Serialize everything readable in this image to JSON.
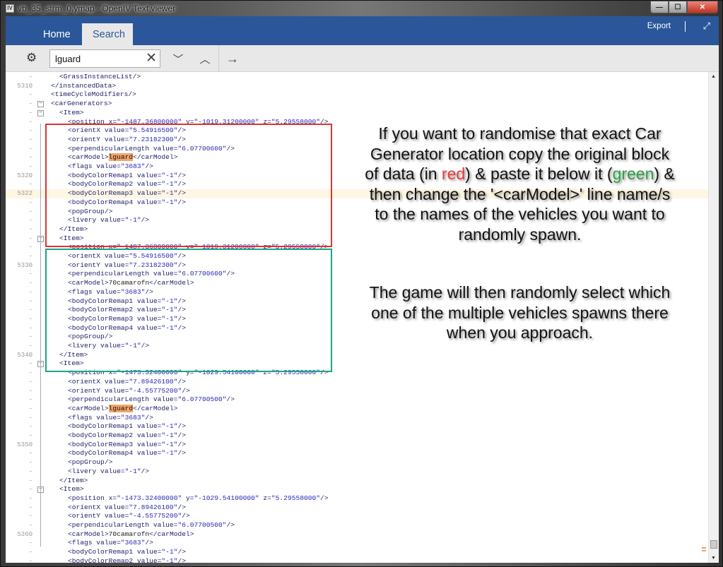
{
  "window": {
    "title": "vb_35_strm_0.ymap - OpenIV Text viewer",
    "app_icon": "IV",
    "controls": {
      "minimize": "—",
      "maximize": "☐",
      "close": "✕"
    }
  },
  "ribbon": {
    "tabs": [
      {
        "label": "Home",
        "active": false
      },
      {
        "label": "Search",
        "active": true
      }
    ],
    "export_label": "Export",
    "expand_icon": "⤢",
    "accent_color": "#2b579a"
  },
  "toolbar": {
    "settings_icon": "⚙",
    "search_value": "lguard",
    "clear_icon": "✕",
    "next_icon": "﹀",
    "prev_icon": "︿",
    "go_icon": "→"
  },
  "editor": {
    "current_line": 5322,
    "highlight_term": "lguard",
    "lines": [
      {
        "num": "-",
        "indent": 2,
        "parts": [
          [
            "tag",
            "<GrassInstanceList/>"
          ]
        ]
      },
      {
        "num": "5310",
        "indent": 1,
        "parts": [
          [
            "tag",
            "</instancedData>"
          ]
        ]
      },
      {
        "num": "-",
        "indent": 1,
        "parts": [
          [
            "tag",
            "<timeCycleModifiers/>"
          ]
        ]
      },
      {
        "num": "-",
        "indent": 1,
        "fold": true,
        "parts": [
          [
            "tag",
            "<carGenerators>"
          ]
        ]
      },
      {
        "num": "-",
        "indent": 2,
        "fold": true,
        "parts": [
          [
            "tag",
            "<Item>"
          ]
        ]
      },
      {
        "num": "-",
        "indent": 3,
        "parts": [
          [
            "tag",
            "<position x="
          ],
          [
            "str",
            "\"-1487.36800000\""
          ],
          [
            "tag",
            " y="
          ],
          [
            "str",
            "\"-1019.31200000\""
          ],
          [
            "tag",
            " z="
          ],
          [
            "str",
            "\"5.29558000\""
          ],
          [
            "tag",
            "/>"
          ]
        ]
      },
      {
        "num": "-",
        "indent": 3,
        "parts": [
          [
            "tag",
            "<orientX value="
          ],
          [
            "str",
            "\"5.54916500\""
          ],
          [
            "tag",
            "/>"
          ]
        ]
      },
      {
        "num": "-",
        "indent": 3,
        "parts": [
          [
            "tag",
            "<orientY value="
          ],
          [
            "str",
            "\"7.23182300\""
          ],
          [
            "tag",
            "/>"
          ]
        ]
      },
      {
        "num": "-",
        "indent": 3,
        "parts": [
          [
            "tag",
            "<perpendicularLength value="
          ],
          [
            "str",
            "\"6.07700600\""
          ],
          [
            "tag",
            "/>"
          ]
        ]
      },
      {
        "num": "-",
        "indent": 3,
        "parts": [
          [
            "tag",
            "<carModel>"
          ],
          [
            "hl",
            "lguard"
          ],
          [
            "tag",
            "</carModel>"
          ]
        ]
      },
      {
        "num": "-",
        "indent": 3,
        "parts": [
          [
            "tag",
            "<flags value="
          ],
          [
            "str",
            "\"3683\""
          ],
          [
            "tag",
            "/>"
          ]
        ]
      },
      {
        "num": "5320",
        "indent": 3,
        "parts": [
          [
            "tag",
            "<bodyColorRemap1 value="
          ],
          [
            "str",
            "\"-1\""
          ],
          [
            "tag",
            "/>"
          ]
        ]
      },
      {
        "num": "-",
        "indent": 3,
        "parts": [
          [
            "tag",
            "<bodyColorRemap2 value="
          ],
          [
            "str",
            "\"-1\""
          ],
          [
            "tag",
            "/>"
          ]
        ]
      },
      {
        "num": "5322",
        "indent": 3,
        "current": true,
        "parts": [
          [
            "tag",
            "<bodyColorRemap3 value="
          ],
          [
            "str",
            "\"-1\""
          ],
          [
            "tag",
            "/>"
          ]
        ]
      },
      {
        "num": "-",
        "indent": 3,
        "parts": [
          [
            "tag",
            "<bodyColorRemap4 value="
          ],
          [
            "str",
            "\"-1\""
          ],
          [
            "tag",
            "/>"
          ]
        ]
      },
      {
        "num": "-",
        "indent": 3,
        "parts": [
          [
            "tag",
            "<popGroup/>"
          ]
        ]
      },
      {
        "num": "-",
        "indent": 3,
        "parts": [
          [
            "tag",
            "<livery value="
          ],
          [
            "str",
            "\"-1\""
          ],
          [
            "tag",
            "/>"
          ]
        ]
      },
      {
        "num": "-",
        "indent": 2,
        "parts": [
          [
            "tag",
            "</Item>"
          ]
        ]
      },
      {
        "num": "-",
        "indent": 2,
        "fold": true,
        "parts": [
          [
            "tag",
            "<Item>"
          ]
        ]
      },
      {
        "num": "-",
        "indent": 3,
        "parts": [
          [
            "tag",
            "<position x="
          ],
          [
            "str",
            "\"-1487.36800000\""
          ],
          [
            "tag",
            " y="
          ],
          [
            "str",
            "\"-1019.31200000\""
          ],
          [
            "tag",
            " z="
          ],
          [
            "str",
            "\"5.29558000\""
          ],
          [
            "tag",
            "/>"
          ]
        ]
      },
      {
        "num": "-",
        "indent": 3,
        "parts": [
          [
            "tag",
            "<orientX value="
          ],
          [
            "str",
            "\"5.54916500\""
          ],
          [
            "tag",
            "/>"
          ]
        ]
      },
      {
        "num": "5330",
        "indent": 3,
        "parts": [
          [
            "tag",
            "<orientY value="
          ],
          [
            "str",
            "\"7.23182300\""
          ],
          [
            "tag",
            "/>"
          ]
        ]
      },
      {
        "num": "-",
        "indent": 3,
        "parts": [
          [
            "tag",
            "<perpendicularLength value="
          ],
          [
            "str",
            "\"6.07700600\""
          ],
          [
            "tag",
            "/>"
          ]
        ]
      },
      {
        "num": "-",
        "indent": 3,
        "parts": [
          [
            "tag",
            "<carModel>"
          ],
          [
            "plain",
            "70camarofn"
          ],
          [
            "tag",
            "</carModel>"
          ]
        ]
      },
      {
        "num": "-",
        "indent": 3,
        "parts": [
          [
            "tag",
            "<flags value="
          ],
          [
            "str",
            "\"3683\""
          ],
          [
            "tag",
            "/>"
          ]
        ]
      },
      {
        "num": "-",
        "indent": 3,
        "parts": [
          [
            "tag",
            "<bodyColorRemap1 value="
          ],
          [
            "str",
            "\"-1\""
          ],
          [
            "tag",
            "/>"
          ]
        ]
      },
      {
        "num": "-",
        "indent": 3,
        "parts": [
          [
            "tag",
            "<bodyColorRemap2 value="
          ],
          [
            "str",
            "\"-1\""
          ],
          [
            "tag",
            "/>"
          ]
        ]
      },
      {
        "num": "-",
        "indent": 3,
        "parts": [
          [
            "tag",
            "<bodyColorRemap3 value="
          ],
          [
            "str",
            "\"-1\""
          ],
          [
            "tag",
            "/>"
          ]
        ]
      },
      {
        "num": "-",
        "indent": 3,
        "parts": [
          [
            "tag",
            "<bodyColorRemap4 value="
          ],
          [
            "str",
            "\"-1\""
          ],
          [
            "tag",
            "/>"
          ]
        ]
      },
      {
        "num": "-",
        "indent": 3,
        "parts": [
          [
            "tag",
            "<popGroup/>"
          ]
        ]
      },
      {
        "num": "-",
        "indent": 3,
        "parts": [
          [
            "tag",
            "<livery value="
          ],
          [
            "str",
            "\"-1\""
          ],
          [
            "tag",
            "/>"
          ]
        ]
      },
      {
        "num": "5340",
        "indent": 2,
        "parts": [
          [
            "tag",
            "</Item>"
          ]
        ]
      },
      {
        "num": "-",
        "indent": 2,
        "fold": true,
        "parts": [
          [
            "tag",
            "<Item>"
          ]
        ]
      },
      {
        "num": "-",
        "indent": 3,
        "parts": [
          [
            "tag",
            "<position x="
          ],
          [
            "str",
            "\"-1473.32400000\""
          ],
          [
            "tag",
            " y="
          ],
          [
            "str",
            "\"-1029.54100000\""
          ],
          [
            "tag",
            " z="
          ],
          [
            "str",
            "\"5.29558000\""
          ],
          [
            "tag",
            "/>"
          ]
        ]
      },
      {
        "num": "-",
        "indent": 3,
        "parts": [
          [
            "tag",
            "<orientX value="
          ],
          [
            "str",
            "\"7.89426100\""
          ],
          [
            "tag",
            "/>"
          ]
        ]
      },
      {
        "num": "-",
        "indent": 3,
        "parts": [
          [
            "tag",
            "<orientY value="
          ],
          [
            "str",
            "\"-4.55775200\""
          ],
          [
            "tag",
            "/>"
          ]
        ]
      },
      {
        "num": "-",
        "indent": 3,
        "parts": [
          [
            "tag",
            "<perpendicularLength value="
          ],
          [
            "str",
            "\"6.07700500\""
          ],
          [
            "tag",
            "/>"
          ]
        ]
      },
      {
        "num": "-",
        "indent": 3,
        "parts": [
          [
            "tag",
            "<carModel>"
          ],
          [
            "hl",
            "lguard"
          ],
          [
            "tag",
            "</carModel>"
          ]
        ]
      },
      {
        "num": "-",
        "indent": 3,
        "parts": [
          [
            "tag",
            "<flags value="
          ],
          [
            "str",
            "\"3683\""
          ],
          [
            "tag",
            "/>"
          ]
        ]
      },
      {
        "num": "-",
        "indent": 3,
        "parts": [
          [
            "tag",
            "<bodyColorRemap1 value="
          ],
          [
            "str",
            "\"-1\""
          ],
          [
            "tag",
            "/>"
          ]
        ]
      },
      {
        "num": "-",
        "indent": 3,
        "parts": [
          [
            "tag",
            "<bodyColorRemap2 value="
          ],
          [
            "str",
            "\"-1\""
          ],
          [
            "tag",
            "/>"
          ]
        ]
      },
      {
        "num": "5350",
        "indent": 3,
        "parts": [
          [
            "tag",
            "<bodyColorRemap3 value="
          ],
          [
            "str",
            "\"-1\""
          ],
          [
            "tag",
            "/>"
          ]
        ]
      },
      {
        "num": "-",
        "indent": 3,
        "parts": [
          [
            "tag",
            "<bodyColorRemap4 value="
          ],
          [
            "str",
            "\"-1\""
          ],
          [
            "tag",
            "/>"
          ]
        ]
      },
      {
        "num": "-",
        "indent": 3,
        "parts": [
          [
            "tag",
            "<popGroup/>"
          ]
        ]
      },
      {
        "num": "-",
        "indent": 3,
        "parts": [
          [
            "tag",
            "<livery value="
          ],
          [
            "str",
            "\"-1\""
          ],
          [
            "tag",
            "/>"
          ]
        ]
      },
      {
        "num": "-",
        "indent": 2,
        "parts": [
          [
            "tag",
            "</Item>"
          ]
        ]
      },
      {
        "num": "-",
        "indent": 2,
        "fold": true,
        "parts": [
          [
            "tag",
            "<Item>"
          ]
        ]
      },
      {
        "num": "-",
        "indent": 3,
        "parts": [
          [
            "tag",
            "<position x="
          ],
          [
            "str",
            "\"-1473.32400000\""
          ],
          [
            "tag",
            " y="
          ],
          [
            "str",
            "\"-1029.54100000\""
          ],
          [
            "tag",
            " z="
          ],
          [
            "str",
            "\"5.29558000\""
          ],
          [
            "tag",
            "/>"
          ]
        ]
      },
      {
        "num": "-",
        "indent": 3,
        "parts": [
          [
            "tag",
            "<orientX value="
          ],
          [
            "str",
            "\"7.89426100\""
          ],
          [
            "tag",
            "/>"
          ]
        ]
      },
      {
        "num": "-",
        "indent": 3,
        "parts": [
          [
            "tag",
            "<orientY value="
          ],
          [
            "str",
            "\"-4.55775200\""
          ],
          [
            "tag",
            "/>"
          ]
        ]
      },
      {
        "num": "-",
        "indent": 3,
        "parts": [
          [
            "tag",
            "<perpendicularLength value="
          ],
          [
            "str",
            "\"6.07700500\""
          ],
          [
            "tag",
            "/>"
          ]
        ]
      },
      {
        "num": "5360",
        "indent": 3,
        "parts": [
          [
            "tag",
            "<carModel>"
          ],
          [
            "plain",
            "70camarofn"
          ],
          [
            "tag",
            "</carModel>"
          ]
        ]
      },
      {
        "num": "-",
        "indent": 3,
        "parts": [
          [
            "tag",
            "<flags value="
          ],
          [
            "str",
            "\"3683\""
          ],
          [
            "tag",
            "/>"
          ]
        ]
      },
      {
        "num": "-",
        "indent": 3,
        "parts": [
          [
            "tag",
            "<bodyColorRemap1 value="
          ],
          [
            "str",
            "\"-1\""
          ],
          [
            "tag",
            "/>"
          ]
        ]
      },
      {
        "num": "-",
        "indent": 3,
        "parts": [
          [
            "tag",
            "<bodyColorRemap2 value="
          ],
          [
            "str",
            "\"-1\""
          ],
          [
            "tag",
            "/>"
          ]
        ]
      }
    ]
  },
  "annotation": {
    "paragraph1": [
      {
        "text": "If you want to randomise that exact Car Generator location copy the original block of data (in "
      },
      {
        "text": "red",
        "color": "red"
      },
      {
        "text": ") & paste it below it ("
      },
      {
        "text": "green",
        "color": "green"
      },
      {
        "text": ") & then change the '<carModel>' line name/s to the names of the vehicles you want to randomly spawn."
      }
    ],
    "paragraph2": "The game will then randomly select which one of the multiple vehicles spawns there when you approach.",
    "red_box_color": "#e03232",
    "green_box_color": "#1aa584"
  },
  "scrollbar": {
    "up_icon": "▲",
    "down_icon": "▼"
  }
}
